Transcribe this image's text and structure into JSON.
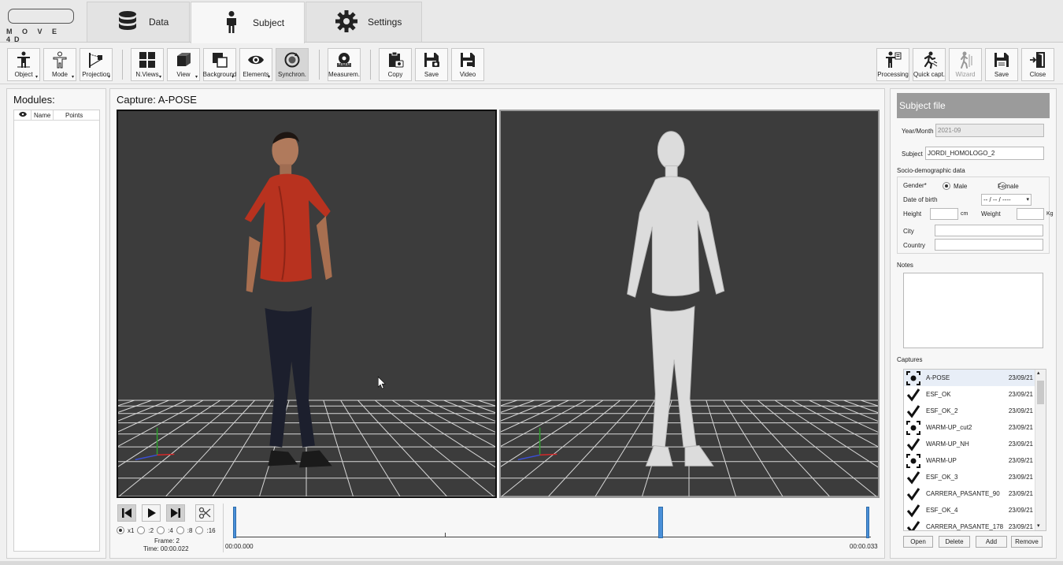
{
  "logo": {
    "text": "M O V E 4D"
  },
  "tabs": [
    {
      "label": "Data",
      "icon": "database-icon"
    },
    {
      "label": "Subject",
      "icon": "person-icon",
      "active": true
    },
    {
      "label": "Settings",
      "icon": "gear-icon"
    }
  ],
  "toolbar": {
    "left": [
      {
        "label": "Object",
        "icon": "object-person-icon",
        "dropdown": true
      },
      {
        "label": "Mode",
        "icon": "mode-person-icon",
        "dropdown": true
      },
      {
        "label": "Projection",
        "icon": "projection-icon",
        "dropdown": true
      },
      {
        "label": "N.Views",
        "icon": "grid-icon",
        "dropdown": true
      },
      {
        "label": "View",
        "icon": "cube-icon",
        "dropdown": true
      },
      {
        "label": "Background",
        "icon": "background-icon",
        "dropdown": true
      },
      {
        "label": "Elements",
        "icon": "eye-icon",
        "dropdown": true
      },
      {
        "label": "Synchron.",
        "icon": "sync-icon",
        "pressed": true
      },
      {
        "label": "Measurem.",
        "icon": "measure-tape-icon"
      },
      {
        "label": "Copy",
        "icon": "clipboard-icon"
      },
      {
        "label": "Save",
        "icon": "floppy-camera-icon"
      },
      {
        "label": "Video",
        "icon": "floppy-video-icon"
      }
    ],
    "right": [
      {
        "label": "Processing",
        "icon": "processing-person-icon"
      },
      {
        "label": "Quick capt.",
        "icon": "running-icon"
      },
      {
        "label": "Wizard",
        "icon": "walking-icon",
        "disabled": true
      },
      {
        "label": "Save",
        "icon": "floppy-icon"
      },
      {
        "label": "Close",
        "icon": "exit-door-icon"
      }
    ]
  },
  "modules": {
    "title": "Modules:",
    "columns": [
      "Name",
      "Points"
    ]
  },
  "capture": {
    "title": "Capture: A-POSE"
  },
  "playback": {
    "speeds": [
      "x1",
      ":2",
      ":4",
      ":8",
      ":16"
    ],
    "selected_speed": "x1",
    "frame": "Frame: 2",
    "time": "Time: 00:00.022",
    "start_time": "00:00.000",
    "end_time": "00:00.033",
    "current_position": 0.67
  },
  "subject_file": {
    "title": "Subject file",
    "year_month_label": "Year/Month",
    "year_month_value": "2021-09",
    "subject_label": "Subject",
    "subject_value": "JORDI_HOMOLOGO_2",
    "socio_title": "Socio-demographic data",
    "gender_label": "Gender*",
    "male_label": "Male",
    "female_label": "Female",
    "gender_selected": "Male",
    "dob_label": "Date of birth",
    "dob_value": "-- / -- / ----",
    "height_label": "Height",
    "height_unit": "cm",
    "weight_label": "Weight",
    "weight_unit": "Kg",
    "city_label": "City",
    "country_label": "Country",
    "notes_label": "Notes",
    "captures_label": "Captures"
  },
  "captures": [
    {
      "name": "A-POSE",
      "date": "23/09/21",
      "icon": "target-icon",
      "selected": true
    },
    {
      "name": "ESF_OK",
      "date": "23/09/21",
      "icon": "check-icon"
    },
    {
      "name": "ESF_OK_2",
      "date": "23/09/21",
      "icon": "check-icon"
    },
    {
      "name": "WARM-UP_cut2",
      "date": "23/09/21",
      "icon": "target-icon"
    },
    {
      "name": "WARM-UP_NH",
      "date": "23/09/21",
      "icon": "check-icon"
    },
    {
      "name": "WARM-UP",
      "date": "23/09/21",
      "icon": "target-icon"
    },
    {
      "name": "ESF_OK_3",
      "date": "23/09/21",
      "icon": "check-icon"
    },
    {
      "name": "CARRERA_PASANTE_90",
      "date": "23/09/21",
      "icon": "check-icon"
    },
    {
      "name": "ESF_OK_4",
      "date": "23/09/21",
      "icon": "check-icon"
    },
    {
      "name": "CARRERA_PASANTE_178",
      "date": "23/09/21",
      "icon": "check-icon"
    }
  ],
  "capture_buttons": [
    "Open",
    "Delete",
    "Add",
    "Remove"
  ]
}
